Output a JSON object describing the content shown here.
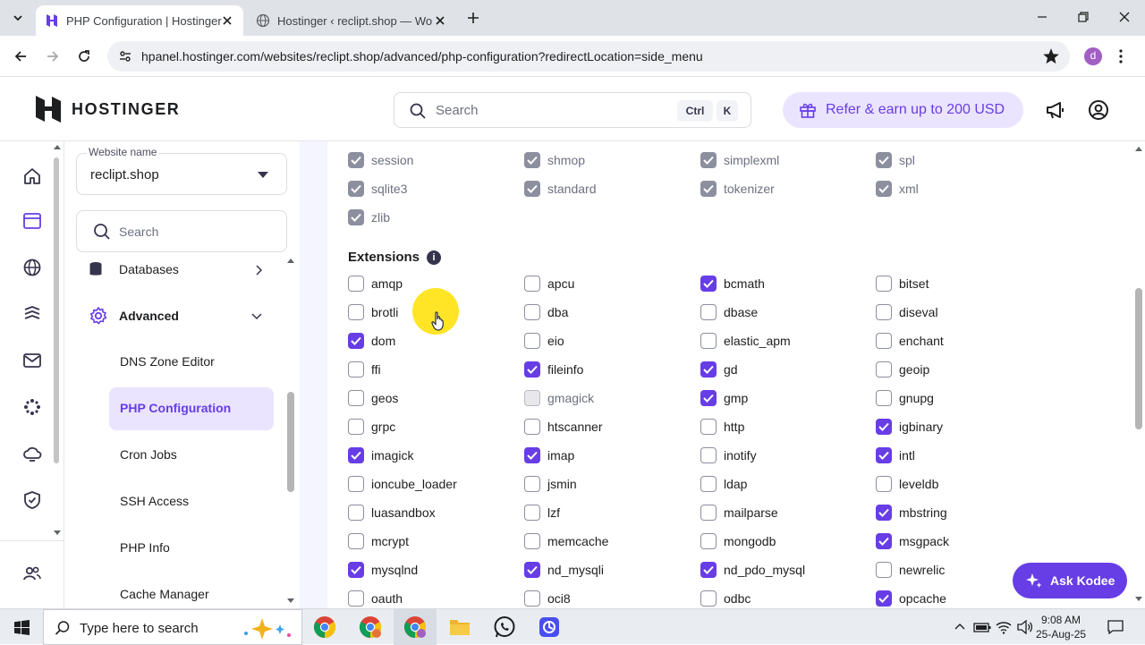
{
  "browser": {
    "tabs": [
      {
        "title": "PHP Configuration | Hostinger",
        "active": true
      },
      {
        "title": "Hostinger ‹ reclipt.shop — Wo",
        "active": false
      }
    ],
    "url": "hpanel.hostinger.com/websites/reclipt.shop/advanced/php-configuration?redirectLocation=side_menu",
    "profile_initial": "d"
  },
  "header": {
    "brand": "HOSTINGER",
    "search_placeholder": "Search",
    "kbd1": "Ctrl",
    "kbd2": "K",
    "refer_label": "Refer & earn up to 200 USD"
  },
  "sidebar": {
    "website_name_label": "Website name",
    "website_name_value": "reclipt.shop",
    "search_placeholder": "Search",
    "databases": "Databases",
    "advanced": "Advanced",
    "sub_items": [
      "DNS Zone Editor",
      "PHP Configuration",
      "Cron Jobs",
      "SSH Access",
      "PHP Info",
      "Cache Manager"
    ]
  },
  "main": {
    "default_modules": [
      {
        "name": "session",
        "checked": true
      },
      {
        "name": "shmop",
        "checked": true
      },
      {
        "name": "simplexml",
        "checked": true
      },
      {
        "name": "spl",
        "checked": true
      },
      {
        "name": "sqlite3",
        "checked": true
      },
      {
        "name": "standard",
        "checked": true
      },
      {
        "name": "tokenizer",
        "checked": true
      },
      {
        "name": "xml",
        "checked": true
      },
      {
        "name": "zlib",
        "checked": true
      }
    ],
    "extensions_title": "Extensions",
    "info_glyph": "i",
    "extensions": [
      {
        "name": "amqp",
        "checked": false
      },
      {
        "name": "apcu",
        "checked": false
      },
      {
        "name": "bcmath",
        "checked": true
      },
      {
        "name": "bitset",
        "checked": false
      },
      {
        "name": "brotli",
        "checked": false
      },
      {
        "name": "dba",
        "checked": false
      },
      {
        "name": "dbase",
        "checked": false
      },
      {
        "name": "diseval",
        "checked": false
      },
      {
        "name": "dom",
        "checked": true
      },
      {
        "name": "eio",
        "checked": false
      },
      {
        "name": "elastic_apm",
        "checked": false
      },
      {
        "name": "enchant",
        "checked": false
      },
      {
        "name": "ffi",
        "checked": false
      },
      {
        "name": "fileinfo",
        "checked": true
      },
      {
        "name": "gd",
        "checked": true
      },
      {
        "name": "geoip",
        "checked": false
      },
      {
        "name": "geos",
        "checked": false
      },
      {
        "name": "gmagick",
        "checked": false,
        "disabled": true
      },
      {
        "name": "gmp",
        "checked": true
      },
      {
        "name": "gnupg",
        "checked": false
      },
      {
        "name": "grpc",
        "checked": false
      },
      {
        "name": "htscanner",
        "checked": false
      },
      {
        "name": "http",
        "checked": false
      },
      {
        "name": "igbinary",
        "checked": true
      },
      {
        "name": "imagick",
        "checked": true
      },
      {
        "name": "imap",
        "checked": true
      },
      {
        "name": "inotify",
        "checked": false
      },
      {
        "name": "intl",
        "checked": true
      },
      {
        "name": "ioncube_loader",
        "checked": false
      },
      {
        "name": "jsmin",
        "checked": false
      },
      {
        "name": "ldap",
        "checked": false
      },
      {
        "name": "leveldb",
        "checked": false
      },
      {
        "name": "luasandbox",
        "checked": false
      },
      {
        "name": "lzf",
        "checked": false
      },
      {
        "name": "mailparse",
        "checked": false
      },
      {
        "name": "mbstring",
        "checked": true
      },
      {
        "name": "mcrypt",
        "checked": false
      },
      {
        "name": "memcache",
        "checked": false
      },
      {
        "name": "mongodb",
        "checked": false
      },
      {
        "name": "msgpack",
        "checked": true
      },
      {
        "name": "mysqlnd",
        "checked": true
      },
      {
        "name": "nd_mysqli",
        "checked": true
      },
      {
        "name": "nd_pdo_mysql",
        "checked": true
      },
      {
        "name": "newrelic",
        "checked": false
      },
      {
        "name": "oauth",
        "checked": false
      },
      {
        "name": "oci8",
        "checked": false
      },
      {
        "name": "odbc",
        "checked": false
      },
      {
        "name": "opcache",
        "checked": true
      }
    ]
  },
  "kodee_label": "Ask Kodee",
  "taskbar": {
    "search_placeholder": "Type here to search",
    "time": "9:08 AM",
    "date": "25-Aug-25"
  },
  "colors": {
    "accent": "#673de6",
    "accent_light": "#ebe4ff"
  }
}
